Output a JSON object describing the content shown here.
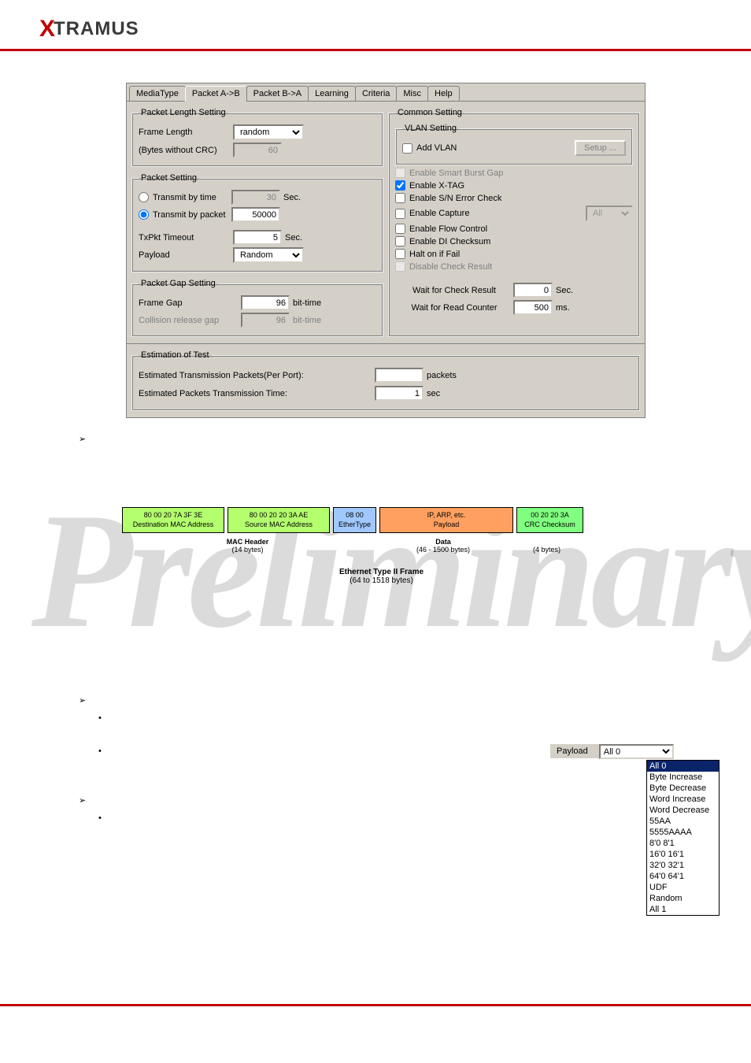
{
  "brand": {
    "x": "X",
    "rest": "TRAMUS"
  },
  "tabs": [
    "MediaType",
    "Packet A->B",
    "Packet B->A",
    "Learning",
    "Criteria",
    "Misc",
    "Help"
  ],
  "activeTab": 1,
  "packetLength": {
    "legend": "Packet Length Setting",
    "frameLengthLabel": "Frame Length",
    "frameLengthValue": "random",
    "bytesNoCrcLabel": "(Bytes without CRC)",
    "bytesNoCrcValue": "60"
  },
  "packetSetting": {
    "legend": "Packet Setting",
    "txByTimeLabel": "Transmit by time",
    "txByTimeValue": "30",
    "secLabel": "Sec.",
    "txByPacketLabel": "Transmit by packet",
    "txByPacketValue": "50000",
    "txPktTimeoutLabel": "TxPkt Timeout",
    "txPktTimeoutValue": "5",
    "payloadLabel": "Payload",
    "payloadValue": "Random"
  },
  "packetGap": {
    "legend": "Packet Gap Setting",
    "frameGapLabel": "Frame Gap",
    "frameGapValue": "96",
    "bitTime": "bit-time",
    "collisionLabel": "Collision release gap",
    "collisionValue": "96"
  },
  "commonSetting": {
    "legend": "Common Setting",
    "vlanLegend": "VLAN Setting",
    "addVlanLabel": "Add VLAN",
    "setupBtn": "Setup ...",
    "enableSmartBurst": "Enable Smart Burst Gap",
    "enableXtag": "Enable X-TAG",
    "enableSnErr": "Enable S/N Error Check",
    "enableCapture": "Enable Capture",
    "captureSel": "All",
    "enableFlow": "Enable Flow Control",
    "enableDiChk": "Enable DI Checksum",
    "haltOnFail": "Halt on if Fail",
    "disableCheck": "Disable Check Result",
    "waitCheckLabel": "Wait for Check Result",
    "waitCheckValue": "0",
    "waitCheckUnit": "Sec.",
    "waitReadLabel": "Wait for Read Counter",
    "waitReadValue": "500",
    "waitReadUnit": "ms."
  },
  "estimation": {
    "legend": "Estimation of Test",
    "estPacketsLabel": "Estimated Transmission Packets(Per Port):",
    "estPacketsValue": "",
    "packetsUnit": "packets",
    "estTimeLabel": "Estimated Packets Transmission Time:",
    "estTimeValue": "1",
    "secUnit": "sec"
  },
  "diagram": {
    "destMacBytes": "80 00 20 7A 3F 3E",
    "destMacLabel": "Destination MAC Address",
    "srcMacBytes": "80 00 20 20 3A AE",
    "srcMacLabel": "Source MAC Address",
    "etherTypeBytes": "08 00",
    "etherTypeLabel": "EtherType",
    "payloadTop": "IP, ARP, etc.",
    "payloadLabel": "Payload",
    "crcBytes": "00 20 20 3A",
    "crcLabel": "CRC Checksum",
    "macHeader": "MAC Header",
    "macHeaderBytes": "(14 bytes)",
    "dataLabel": "Data",
    "dataBytes": "(46 - 1500 bytes)",
    "crcBytes2": "(4 bytes)",
    "frameLabel": "Ethernet Type II Frame",
    "frameBytes": "(64 to 1518 bytes)"
  },
  "payloadCombo": {
    "label": "Payload",
    "value": "All 0",
    "options": [
      "All 0",
      "Byte Increase",
      "Byte Decrease",
      "Word Increase",
      "Word Decrease",
      "55AA",
      "5555AAAA",
      "8'0 8'1",
      "16'0 16'1",
      "32'0 32'1",
      "64'0 64'1",
      "UDF",
      "Random",
      "All 1"
    ]
  },
  "watermark": "Preliminary"
}
